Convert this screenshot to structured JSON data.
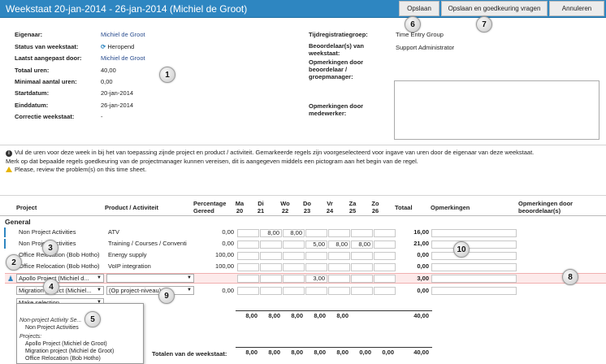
{
  "header": {
    "title": "Weekstaat 20-jan-2014 - 26-jan-2014 (Michiel de Groot)",
    "save": "Opslaan",
    "save_approve": "Opslaan en goedkeuring vragen",
    "cancel": "Annuleren"
  },
  "details": {
    "owner_label": "Eigenaar:",
    "owner": "Michiel de Groot",
    "status_label": "Status van weekstaat:",
    "status": "Heropend",
    "modified_label": "Laatst aangepast door:",
    "modified": "Michiel de Groot",
    "total_label": "Totaal uren:",
    "total": "40,00",
    "min_label": "Minimaal aantal uren:",
    "min": "0,00",
    "start_label": "Startdatum:",
    "start": "20-jan-2014",
    "end_label": "Einddatum:",
    "end": "26-jan-2014",
    "correction_label": "Correctie weekstaat:",
    "correction": "-",
    "group_label": "Tijdregistratiegroep:",
    "group": "Time Entry Group",
    "reviewer_label": "Beoordelaar(s) van weekstaat:",
    "reviewer": "Support Administrator",
    "reviewer_remarks_label": "Opmerkingen door beoordelaar / groepmanager:",
    "employee_remarks_label": "Opmerkingen door medewerker:"
  },
  "info": {
    "line1": "Vul de uren voor deze week in bij het van toepassing zijnde project en product / activiteit. Gemarkeerde regels zijn voorgeselecteerd voor ingave van uren door de eigenaar van deze weekstaat.",
    "line2": "Merk op dat bepaalde regels goedkeuring van de projectmanager kunnen vereisen, dit is aangegeven middels een pictogram aan het begin van de regel.",
    "warning": "Please, review the problem(s) on this time sheet."
  },
  "table": {
    "headers": {
      "project": "Project",
      "product": "Product / Activiteit",
      "pct": "Percentage Gereed",
      "days": [
        {
          "d": "Ma",
          "n": "20"
        },
        {
          "d": "Di",
          "n": "21"
        },
        {
          "d": "Wo",
          "n": "22"
        },
        {
          "d": "Do",
          "n": "23"
        },
        {
          "d": "Vr",
          "n": "24"
        },
        {
          "d": "Za",
          "n": "25"
        },
        {
          "d": "Zo",
          "n": "26"
        }
      ],
      "total": "Totaal",
      "remarks": "Opmerkingen",
      "reviewer_remarks": "Opmerkingen door beoordelaar(s)"
    },
    "group": "General",
    "rows": [
      {
        "project": "Non Project Activities",
        "product": "ATV",
        "pct": "0,00",
        "days": [
          "",
          "8,00",
          "8,00",
          "",
          "",
          "",
          ""
        ],
        "total": "16,00"
      },
      {
        "project": "Non Project Activities",
        "product": "Training / Courses / Conventi",
        "pct": "0,00",
        "days": [
          "",
          "",
          "",
          "5,00",
          "8,00",
          "8,00",
          ""
        ],
        "total": "21,00"
      },
      {
        "project": "Office Relocation (Bob Hotho)",
        "product": "Energy supply",
        "pct": "100,00",
        "days": [
          "",
          "",
          "",
          "",
          "",
          "",
          ""
        ],
        "total": "0,00"
      },
      {
        "project": "Office Relocation (Bob Hotho)",
        "product": "VoIP integration",
        "pct": "100,00",
        "days": [
          "",
          "",
          "",
          "",
          "",
          "",
          ""
        ],
        "total": "0,00"
      },
      {
        "project": "Apollo Project (Michiel d...",
        "product": "",
        "pct": "",
        "days": [
          "",
          "",
          "",
          "3,00",
          "",
          "",
          ""
        ],
        "total": "3,00"
      },
      {
        "project": "Migration project (Michiel...",
        "product": "(Op project-niveau)",
        "pct": "0,00",
        "days": [
          "",
          "",
          "",
          "",
          "",
          "",
          ""
        ],
        "total": "0,00"
      }
    ],
    "make_selection": "Make selection",
    "subtotal": {
      "days": [
        "8,00",
        "8,00",
        "8,00",
        "8,00",
        "8,00",
        "",
        ""
      ],
      "total": "40,00"
    },
    "grand_total_label_1": "Totalen van de weekstaat:",
    "grand_total": {
      "days": [
        "8,00",
        "8,00",
        "8,00",
        "8,00",
        "8,00",
        "0,00",
        "0,00"
      ],
      "total": "40,00"
    }
  },
  "menu": {
    "group1": "Non-project Activity Se...",
    "item1": "Non Project Activities",
    "group2": "Projects:",
    "items": [
      "Apollo Project (Michiel de Groot)",
      "Migration project (Michiel de Groot)",
      "Office Relocation (Bob Hotho)"
    ]
  },
  "callouts": [
    "1",
    "2",
    "3",
    "4",
    "5",
    "6",
    "7",
    "8",
    "9",
    "10"
  ]
}
